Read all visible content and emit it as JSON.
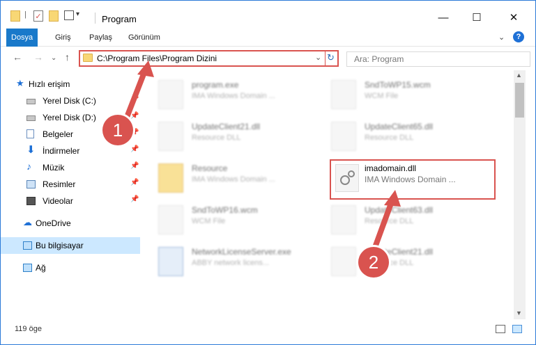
{
  "window": {
    "title": "Program",
    "controls": {
      "minimize": "—",
      "maximize": "☐",
      "close": "✕"
    }
  },
  "ribbon": {
    "tabs": [
      "Dosya",
      "Giriş",
      "Paylaş",
      "Görünüm"
    ],
    "help_label": "?",
    "expand_glyph": "⌄"
  },
  "nav": {
    "back_glyph": "←",
    "forward_glyph": "→",
    "recent_glyph": "⌄",
    "up_glyph": "↑",
    "address": "C:\\Program Files\\Program Dizini",
    "address_caret": "⌄",
    "refresh_glyph": "↻",
    "search_placeholder": "Ara: Program"
  },
  "sidebar": {
    "items": [
      {
        "label": "Hızlı erişim",
        "icon": "star-icon",
        "pinned": false
      },
      {
        "label": "Yerel Disk (C:)",
        "icon": "drive-icon",
        "pinned": true
      },
      {
        "label": "Yerel Disk (D:)",
        "icon": "drive-icon",
        "pinned": true
      },
      {
        "label": "Belgeler",
        "icon": "documents-icon",
        "pinned": true
      },
      {
        "label": "İndirmeler",
        "icon": "download-icon",
        "pinned": true
      },
      {
        "label": "Müzik",
        "icon": "music-icon",
        "pinned": true
      },
      {
        "label": "Resimler",
        "icon": "pictures-icon",
        "pinned": true
      },
      {
        "label": "Videolar",
        "icon": "video-icon",
        "pinned": true
      },
      {
        "label": "OneDrive",
        "icon": "cloud-icon",
        "pinned": false
      },
      {
        "label": "Bu bilgisayar",
        "icon": "computer-icon",
        "pinned": false
      },
      {
        "label": "Ağ",
        "icon": "network-icon",
        "pinned": false
      }
    ],
    "pin_glyph": "📌"
  },
  "files": {
    "items": [
      {
        "name": "program.exe",
        "type": "IMA Windows Domain ..."
      },
      {
        "name": "SndToWP15.wcm",
        "type": "WCM File"
      },
      {
        "name": "UpdateClient21.dll",
        "type": "Resource DLL"
      },
      {
        "name": "UpdateClient65.dll",
        "type": "Resource DLL"
      },
      {
        "name": "Resource",
        "type": "IMA Windows Domain ..."
      },
      {
        "name": "imadomain.dll",
        "type": "IMA Windows Domain ..."
      },
      {
        "name": "SndToWP16.wcm",
        "type": "WCM File"
      },
      {
        "name": "UpdateClient63.dll",
        "type": "Resource DLL"
      },
      {
        "name": "NetworkLicenseServer.exe",
        "type": "ABBY network licens..."
      },
      {
        "name": "UpdateClient21.dll",
        "type": "Resource DLL"
      }
    ]
  },
  "status": {
    "count": "119 öge"
  },
  "annotations": {
    "step1": "1",
    "step2": "2"
  },
  "colors": {
    "accent": "#1979ca",
    "highlight": "#d9534f",
    "selected": "#cce8ff"
  }
}
